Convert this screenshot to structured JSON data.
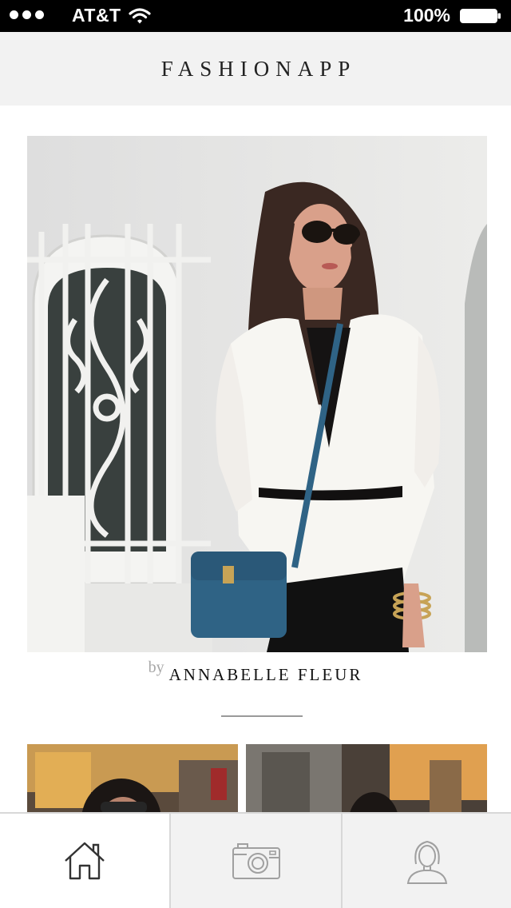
{
  "status_bar": {
    "carrier": "AT&T",
    "battery_percent": "100%",
    "signal_icon": "signal-dots-icon",
    "wifi_icon": "wifi-icon",
    "battery_icon": "battery-icon"
  },
  "header": {
    "title": "FASHIONAPP"
  },
  "feed": {
    "featured_post": {
      "byline_prefix": "by",
      "author": "ANNABELLE FLEUR",
      "photo_icon": "fashion-photo"
    },
    "thumbnails": [
      {
        "icon": "thumbnail-photo"
      },
      {
        "icon": "thumbnail-photo"
      }
    ]
  },
  "tab_bar": {
    "tabs": [
      {
        "icon": "home-icon",
        "active": true
      },
      {
        "icon": "camera-icon",
        "active": false
      },
      {
        "icon": "profile-icon",
        "active": false
      }
    ]
  },
  "colors": {
    "header_background": "#f2f2f2",
    "title_text": "#222222",
    "byline_prefix": "#a8a8a8",
    "divider": "#9a9a9a",
    "tab_bar_background": "#f2f2f2",
    "active_tab_background": "#ffffff",
    "active_icon": "#333333",
    "inactive_icon": "#a0a0a0"
  }
}
